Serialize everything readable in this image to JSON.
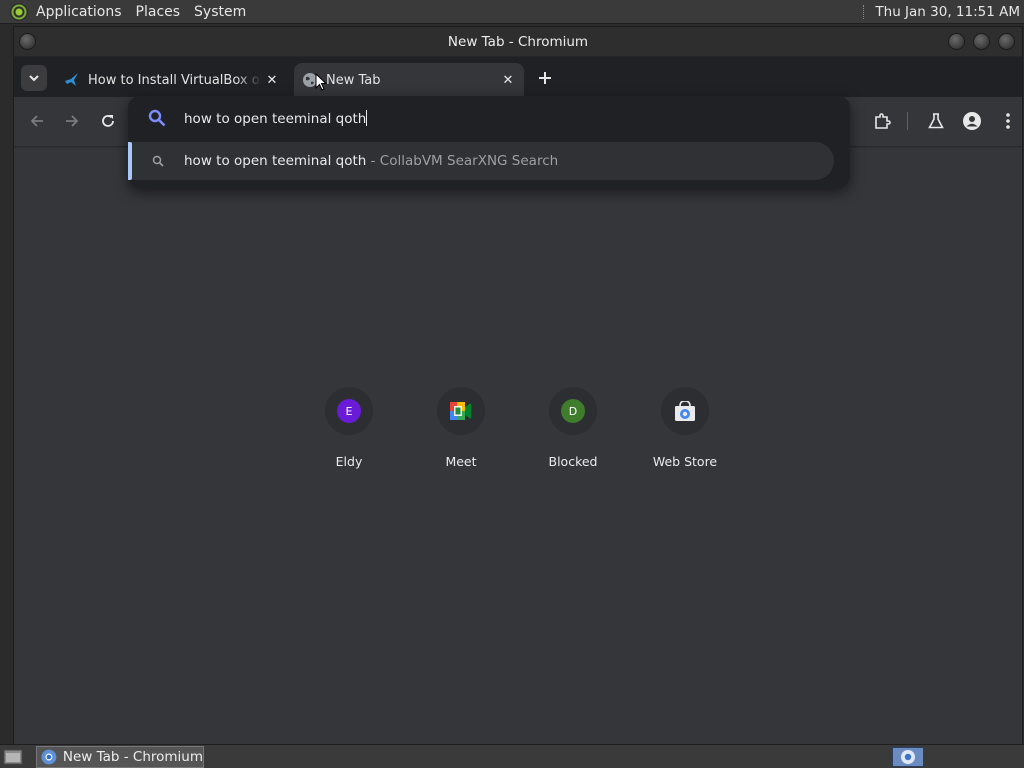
{
  "top_panel": {
    "menus": [
      "Applications",
      "Places",
      "System"
    ],
    "clock": "Thu Jan 30, 11:51 AM"
  },
  "window": {
    "title": "New Tab - Chromium"
  },
  "tabs": [
    {
      "title": "How to Install VirtualBox on",
      "active": false,
      "favicon": "bird-icon"
    },
    {
      "title": "New Tab",
      "active": true,
      "favicon": "globe-icon"
    }
  ],
  "omnibox": {
    "query": "how to open teeminal qoth",
    "suggestion": {
      "text": "how to open teeminal qoth",
      "description": " - CollabVM SearXNG Search"
    }
  },
  "shortcuts": [
    {
      "label": "Eldy",
      "letter": "E",
      "color": "#6a1bd8"
    },
    {
      "label": "Meet",
      "icon": "google-meet-icon"
    },
    {
      "label": "Blocked",
      "letter": "D",
      "color": "#3f7d2c"
    },
    {
      "label": "Web Store",
      "icon": "chrome-web-store-icon"
    }
  ],
  "taskbar": {
    "task": "New Tab - Chromium"
  }
}
